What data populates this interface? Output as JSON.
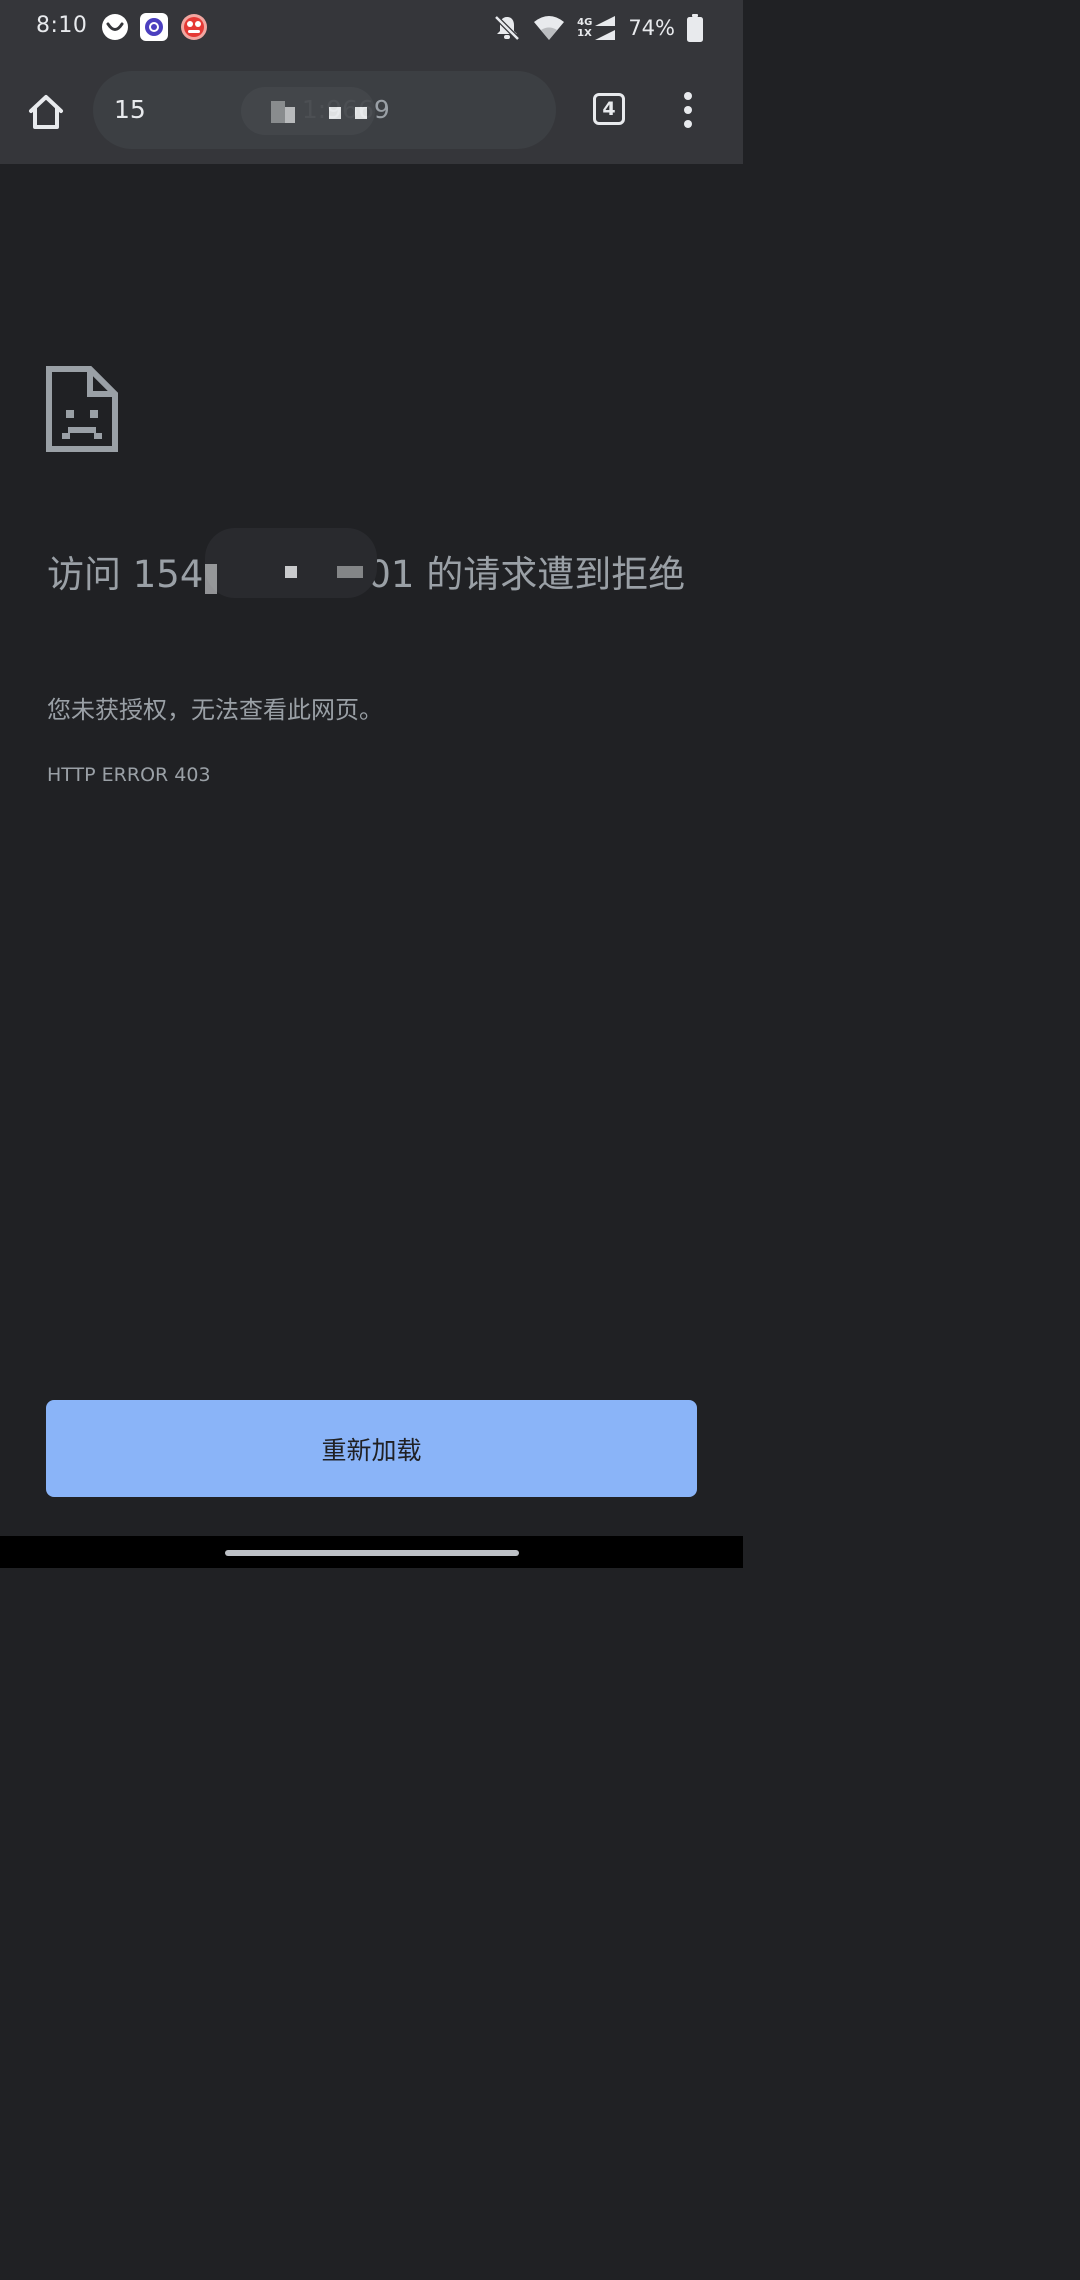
{
  "status_bar": {
    "time": "8:10",
    "notification_icons": [
      "smiley-app-icon",
      "browser-app-icon",
      "red-app-icon"
    ],
    "network_type_top": "4G",
    "network_type_bottom": "1X",
    "battery_percent": "74%"
  },
  "toolbar": {
    "url_prefix": "15",
    "url_suffix": "1:9669",
    "tab_count": "4"
  },
  "error": {
    "heading_prefix": "访问 154",
    "heading_suffix": "01 的请求遭到拒绝",
    "description": "您未获授权，无法查看此网页。",
    "code": "HTTP ERROR 403"
  },
  "reload_button": {
    "label": "重新加载"
  },
  "colors": {
    "background": "#202124",
    "toolbar": "#35363a",
    "omnibox": "#3c3f43",
    "text_secondary": "#9aa0a6",
    "button_accent": "#8ab4f8"
  }
}
